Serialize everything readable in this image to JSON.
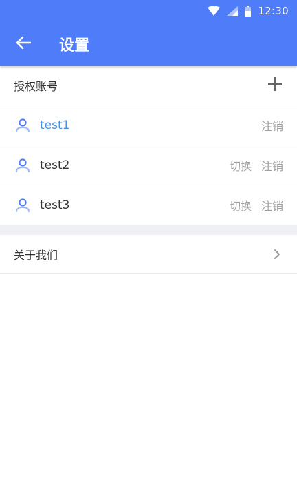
{
  "status_bar": {
    "time": "12:30",
    "icons": [
      "wifi-icon",
      "signal-icon",
      "battery-icon"
    ]
  },
  "app_bar": {
    "title": "设置",
    "back_icon": "arrow-left-icon"
  },
  "accounts_section": {
    "header": "授权账号",
    "add_icon": "plus-icon",
    "accounts": [
      {
        "name": "test1",
        "active": true,
        "actions": [
          "注销"
        ]
      },
      {
        "name": "test2",
        "active": false,
        "actions": [
          "切换",
          "注销"
        ]
      },
      {
        "name": "test3",
        "active": false,
        "actions": [
          "切换",
          "注销"
        ]
      }
    ]
  },
  "about": {
    "label": "关于我们",
    "icon": "chevron-right-icon"
  },
  "colors": {
    "primary": "#4f7df9",
    "active_text": "#4a90e2",
    "secondary_text": "#a0a0a0",
    "divider": "#e8e9ee",
    "section_gap": "#eef0f5"
  }
}
